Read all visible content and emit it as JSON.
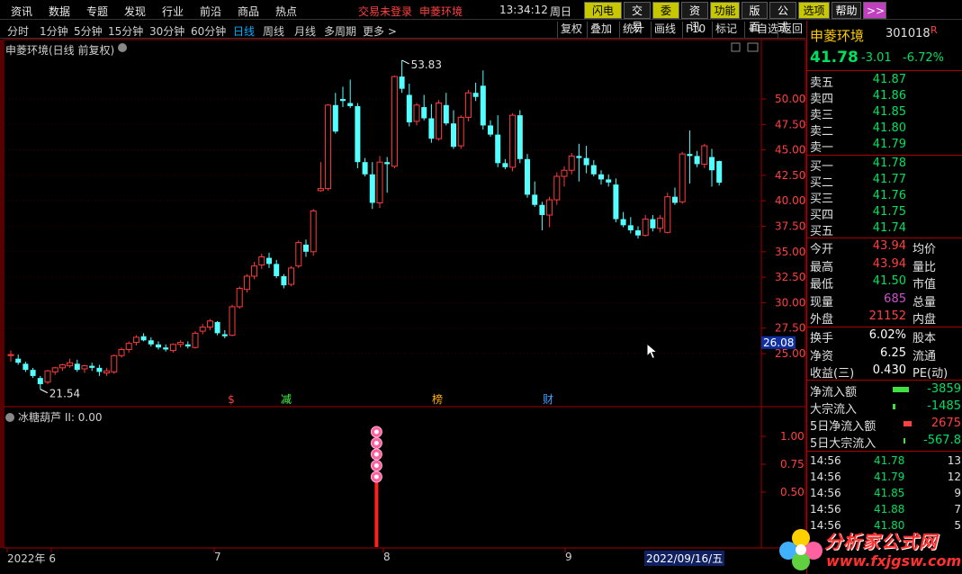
{
  "top_menu": [
    "资讯",
    "数据",
    "专题",
    "发现",
    "行业",
    "前沿",
    "商品",
    "热点"
  ],
  "status": {
    "trade": "交易未登录",
    "stock_name": "申菱环境",
    "time": "13:34:12",
    "weekday": "周日"
  },
  "top_buttons": [
    "闪电手",
    "交易",
    "委托",
    "资讯",
    "功能",
    "版面",
    "公式",
    "选项",
    "帮助",
    ">>"
  ],
  "periods": [
    "分时",
    "1分钟",
    "5分钟",
    "15分钟",
    "30分钟",
    "60分钟",
    "日线",
    "周线",
    "月线",
    "多周期",
    "更多 >"
  ],
  "active_period": "日线",
  "tools": [
    "复权",
    "叠加",
    "统计",
    "画线",
    "F10",
    "标记",
    "+自选",
    "返回"
  ],
  "chart_title": "申菱环境(日线 前复权)",
  "indicator_title": "冰糖葫芦  II: 0.00",
  "price_axis": [
    "50.00",
    "47.50",
    "45.00",
    "42.50",
    "40.00",
    "37.50",
    "35.00",
    "32.50",
    "30.00",
    "27.50",
    "25.00"
  ],
  "price_marker": "26.08",
  "ind_axis": [
    "1.00",
    "0.75",
    "0.50"
  ],
  "high_label": "53.83",
  "low_label": "21.54",
  "event_marks": [
    {
      "text": "$",
      "color": "#ff4040"
    },
    {
      "text": "减",
      "color": "#40ff40"
    },
    {
      "text": "榜",
      "color": "#ffb000"
    },
    {
      "text": "财",
      "color": "#40a0ff"
    }
  ],
  "x_labels": [
    "2022年 6",
    "7",
    "8",
    "9",
    "2022/09/16/五"
  ],
  "chart_data": {
    "type": "candlestick",
    "y_range": [
      21.0,
      55.0
    ],
    "candles": [
      [
        24.8,
        25.3,
        24.2,
        24.9
      ],
      [
        24.5,
        24.9,
        23.9,
        24.1
      ],
      [
        24.0,
        24.2,
        23.2,
        23.4
      ],
      [
        23.4,
        23.6,
        22.6,
        22.8
      ],
      [
        22.6,
        22.8,
        21.5,
        22.0
      ],
      [
        22.2,
        23.4,
        22.0,
        23.3
      ],
      [
        23.2,
        23.7,
        22.9,
        23.6
      ],
      [
        23.6,
        24.0,
        23.3,
        23.9
      ],
      [
        23.8,
        24.5,
        23.6,
        24.1
      ],
      [
        24.0,
        24.4,
        23.2,
        23.4
      ],
      [
        23.5,
        23.9,
        23.1,
        23.8
      ],
      [
        23.8,
        24.1,
        23.3,
        23.6
      ],
      [
        23.6,
        23.9,
        22.8,
        23.2
      ],
      [
        23.1,
        23.6,
        22.8,
        23.3
      ],
      [
        23.2,
        24.9,
        23.0,
        24.8
      ],
      [
        24.8,
        25.6,
        24.6,
        25.4
      ],
      [
        25.4,
        26.2,
        25.1,
        26.0
      ],
      [
        26.1,
        26.8,
        25.8,
        26.6
      ],
      [
        26.7,
        27.0,
        26.2,
        26.3
      ],
      [
        26.3,
        26.6,
        25.7,
        25.9
      ],
      [
        25.9,
        26.2,
        25.4,
        25.6
      ],
      [
        25.6,
        25.9,
        25.2,
        25.4
      ],
      [
        25.3,
        26.0,
        25.1,
        25.9
      ],
      [
        25.9,
        26.3,
        25.6,
        26.1
      ],
      [
        25.9,
        26.2,
        25.5,
        25.7
      ],
      [
        25.6,
        27.2,
        25.5,
        27.0
      ],
      [
        27.2,
        27.9,
        26.9,
        27.6
      ],
      [
        27.6,
        28.4,
        27.3,
        28.2
      ],
      [
        28.1,
        28.2,
        26.8,
        27.0
      ],
      [
        26.9,
        27.3,
        26.5,
        26.7
      ],
      [
        26.8,
        29.8,
        26.7,
        29.6
      ],
      [
        29.6,
        31.6,
        29.4,
        31.4
      ],
      [
        31.3,
        32.8,
        31.0,
        32.6
      ],
      [
        32.6,
        34.0,
        32.3,
        33.6
      ],
      [
        33.7,
        34.8,
        33.3,
        34.5
      ],
      [
        34.4,
        34.9,
        33.4,
        33.8
      ],
      [
        33.8,
        34.2,
        32.4,
        32.6
      ],
      [
        32.6,
        32.8,
        31.4,
        31.7
      ],
      [
        31.8,
        33.6,
        31.6,
        33.4
      ],
      [
        33.6,
        36.1,
        33.4,
        35.9
      ],
      [
        35.7,
        36.2,
        34.5,
        35.0
      ],
      [
        35.0,
        39.2,
        34.6,
        39.0
      ],
      [
        41.0,
        43.8,
        40.9,
        41.2
      ],
      [
        41.2,
        49.5,
        41.0,
        49.4
      ],
      [
        49.4,
        50.6,
        46.6,
        46.8
      ],
      [
        50.0,
        51.2,
        49.2,
        49.8
      ],
      [
        49.6,
        51.9,
        49.1,
        49.3
      ],
      [
        49.3,
        49.6,
        43.2,
        43.8
      ],
      [
        43.8,
        44.2,
        42.4,
        42.6
      ],
      [
        42.6,
        43.8,
        39.2,
        39.8
      ],
      [
        39.8,
        44.4,
        39.3,
        43.8
      ],
      [
        43.8,
        44.3,
        40.8,
        43.6
      ],
      [
        43.4,
        52.3,
        43.2,
        52.2
      ],
      [
        52.2,
        53.8,
        50.6,
        51.0
      ],
      [
        50.4,
        51.5,
        47.3,
        47.7
      ],
      [
        47.8,
        49.6,
        47.4,
        49.4
      ],
      [
        49.2,
        50.4,
        47.9,
        48.1
      ],
      [
        48.1,
        49.5,
        45.7,
        46.1
      ],
      [
        46.1,
        49.9,
        45.9,
        49.6
      ],
      [
        49.4,
        50.6,
        47.4,
        47.6
      ],
      [
        47.6,
        48.9,
        45.1,
        45.3
      ],
      [
        45.4,
        48.4,
        45.1,
        48.2
      ],
      [
        48.2,
        50.9,
        47.8,
        50.6
      ],
      [
        50.6,
        51.6,
        49.8,
        50.2
      ],
      [
        51.3,
        52.8,
        47.0,
        47.4
      ],
      [
        47.4,
        47.9,
        46.3,
        46.5
      ],
      [
        46.5,
        48.4,
        43.3,
        43.7
      ],
      [
        43.7,
        44.1,
        43.1,
        43.3
      ],
      [
        43.3,
        48.6,
        42.9,
        48.4
      ],
      [
        48.4,
        48.9,
        43.7,
        44.1
      ],
      [
        44.1,
        44.6,
        40.3,
        40.6
      ],
      [
        40.6,
        41.9,
        39.4,
        39.6
      ],
      [
        39.6,
        39.9,
        37.1,
        38.6
      ],
      [
        38.6,
        40.4,
        37.4,
        40.1
      ],
      [
        40.1,
        42.8,
        39.6,
        42.4
      ],
      [
        42.4,
        43.4,
        41.4,
        43.0
      ],
      [
        43.0,
        44.7,
        42.6,
        44.4
      ],
      [
        44.4,
        45.6,
        41.9,
        44.2
      ],
      [
        44.2,
        45.4,
        42.7,
        43.5
      ],
      [
        43.5,
        44.0,
        42.4,
        42.6
      ],
      [
        42.6,
        43.0,
        41.6,
        42.1
      ],
      [
        42.1,
        42.6,
        41.4,
        41.8
      ],
      [
        41.6,
        42.2,
        37.9,
        38.2
      ],
      [
        38.2,
        38.9,
        37.4,
        37.6
      ],
      [
        37.6,
        38.4,
        36.8,
        37.1
      ],
      [
        37.1,
        37.5,
        36.3,
        36.6
      ],
      [
        36.6,
        38.6,
        36.5,
        38.2
      ],
      [
        38.2,
        38.6,
        37.0,
        37.3
      ],
      [
        37.3,
        38.6,
        36.9,
        38.3
      ],
      [
        36.9,
        40.8,
        36.8,
        40.4
      ],
      [
        40.4,
        41.3,
        39.6,
        39.8
      ],
      [
        39.9,
        44.8,
        39.7,
        44.6
      ],
      [
        44.6,
        46.9,
        41.7,
        44.4
      ],
      [
        44.4,
        44.9,
        43.3,
        43.6
      ],
      [
        43.6,
        45.6,
        43.2,
        45.4
      ],
      [
        44.3,
        45.1,
        41.4,
        43.0
      ],
      [
        43.9,
        43.94,
        41.5,
        41.78
      ]
    ],
    "indicator": {
      "series": "II",
      "value": 0.0,
      "stack_index": 42,
      "stack_count": 5,
      "ylim": [
        0,
        1.2
      ]
    }
  },
  "quote": {
    "name": "申菱环境",
    "code": "301018",
    "tag": "R",
    "price": "41.78",
    "change": "-3.01",
    "pct": "-6.72%",
    "asks": [
      {
        "label": "卖五",
        "price": "41.87"
      },
      {
        "label": "卖四",
        "price": "41.86"
      },
      {
        "label": "卖三",
        "price": "41.85"
      },
      {
        "label": "卖二",
        "price": "41.80"
      },
      {
        "label": "卖一",
        "price": "41.79"
      }
    ],
    "bids": [
      {
        "label": "买一",
        "price": "41.78"
      },
      {
        "label": "买二",
        "price": "41.77"
      },
      {
        "label": "买三",
        "price": "41.76"
      },
      {
        "label": "买四",
        "price": "41.75"
      },
      {
        "label": "买五",
        "price": "41.74"
      }
    ],
    "stats": [
      {
        "l": "今开",
        "v": "43.94",
        "r": "均价",
        "c": "red"
      },
      {
        "l": "最高",
        "v": "43.94",
        "r": "量比",
        "c": "red"
      },
      {
        "l": "最低",
        "v": "41.50",
        "r": "市值",
        "c": "green"
      },
      {
        "l": "现量",
        "v": "685",
        "r": "总量",
        "c": "purple"
      },
      {
        "l": "外盘",
        "v": "21152",
        "r": "内盘",
        "c": "red"
      }
    ],
    "stats2": [
      {
        "l": "换手",
        "v": "6.02%",
        "r": "股本"
      },
      {
        "l": "净资",
        "v": "6.25",
        "r": "流通"
      },
      {
        "l": "收益(三)",
        "v": "0.430",
        "r": "PE(动)"
      }
    ],
    "flows": [
      {
        "l": "净流入额",
        "v": "-3859",
        "bar": "#40e040",
        "bw": 36
      },
      {
        "l": "大宗流入",
        "v": "-1485",
        "bar": "#40e040",
        "bw": 6
      },
      {
        "l": "5日净流入额",
        "v": "2675",
        "bar": "#ff4040",
        "bw": 18
      },
      {
        "l": "5日大宗流入",
        "v": "-567.8",
        "bar": "#40e040",
        "bw": 3
      }
    ],
    "ticks": [
      {
        "t": "14:56",
        "p": "41.78",
        "q": "13",
        "c": "green"
      },
      {
        "t": "14:56",
        "p": "41.79",
        "q": "12",
        "c": "green"
      },
      {
        "t": "14:56",
        "p": "41.85",
        "q": "9",
        "c": "green"
      },
      {
        "t": "14:56",
        "p": "41.88",
        "q": "7",
        "c": "green"
      },
      {
        "t": "14:56",
        "p": "41.80",
        "q": "5",
        "c": "green"
      }
    ]
  },
  "watermark": {
    "brand": "分析家公式网",
    "url": "www.fxjgsw.com"
  }
}
